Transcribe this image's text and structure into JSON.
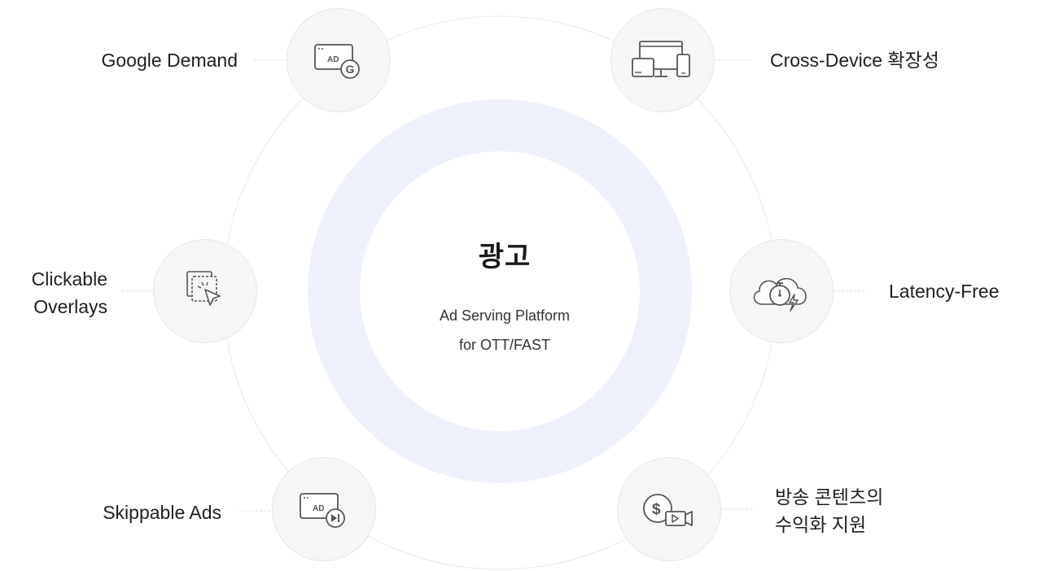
{
  "center": {
    "title": "광고",
    "subtitle_line1": "Ad Serving Platform",
    "subtitle_line2": "for OTT/FAST"
  },
  "features": [
    {
      "label_lines": [
        "Google Demand"
      ],
      "icon": "ad-google-icon"
    },
    {
      "label_lines": [
        "Cross-Device 확장성"
      ],
      "icon": "multi-device-icon"
    },
    {
      "label_lines": [
        "Clickable",
        "Overlays"
      ],
      "icon": "click-overlay-icon"
    },
    {
      "label_lines": [
        "Latency-Free"
      ],
      "icon": "cloud-stopwatch-icon"
    },
    {
      "label_lines": [
        "Skippable Ads"
      ],
      "icon": "ad-skip-icon"
    },
    {
      "label_lines": [
        "방송 콘텐츠의",
        "수익화 지원"
      ],
      "icon": "dollar-video-icon"
    }
  ],
  "colors": {
    "ring": "#eef1fb",
    "node_bg": "#f6f6f6",
    "icon_stroke": "#555555"
  }
}
